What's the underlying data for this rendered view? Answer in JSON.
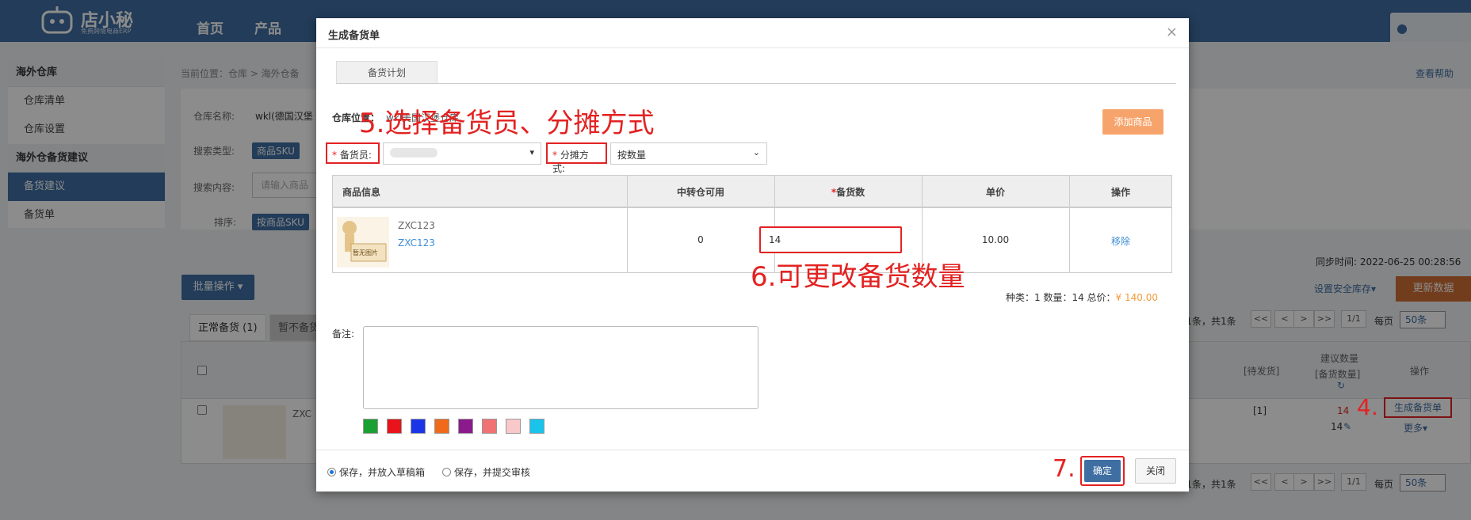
{
  "app": {
    "logo_text": "店小秘",
    "logo_sub": "免费跨境电商ERP",
    "nav": [
      "首页",
      "产品"
    ]
  },
  "sidebar": {
    "group1": "海外仓库",
    "items1": [
      "仓库清单",
      "仓库设置"
    ],
    "group2": "海外仓备货建议",
    "items2": [
      "备货建议",
      "备货单"
    ]
  },
  "bg": {
    "breadcrumb": "当前位置：仓库 > 海外仓备",
    "help": "查看帮助",
    "warehouse_label": "仓库名称:",
    "warehouse_value": "wkl(德国汉堡",
    "search_type_label": "搜索类型:",
    "search_type_value": "商品SKU",
    "search_content_label": "搜索内容:",
    "search_content_placeholder": "请输入商品",
    "sort_label": "排序:",
    "sort_value": "按商品SKU",
    "sync_time": "同步时间: 2022-06-25 00:28:56",
    "batch_label": "批量操作",
    "safe_stock_link": "设置安全库存",
    "update_btn": "更新数据",
    "tab_normal": "正常备货 (1)",
    "tab_pending": "暂不备货",
    "pager_text": "-1条，共1条",
    "pager_page": "1/1",
    "pager_per": "每页",
    "pager_size": "50条",
    "pager_text2": "-1条，共1条",
    "col_pending": "[待发货]",
    "col_suggest": "建议数量",
    "col_suggest2": "[备货数量]",
    "col_action": "操作",
    "row_pending": "[1]",
    "row_suggest": "14",
    "row_qty": "14",
    "row_sku": "ZXC",
    "row_gen": "生成备货单",
    "row_more": "更多",
    "no_image": "暂无图片"
  },
  "modal": {
    "title": "生成备货单",
    "close_icon": "×",
    "tab": "备货计划",
    "warehouse_location_label": "仓库位置：",
    "warehouse_location_value": "wkl美国汉堡仓库",
    "add_product_btn": "添加商品",
    "stocker_label": "备货员:",
    "allocation_label": "分摊方式:",
    "allocation_value": "按数量",
    "table": {
      "headers": [
        "商品信息",
        "中转仓可用",
        "备货数",
        "单价",
        "操作"
      ],
      "row": {
        "sku_gray": "ZXC123",
        "sku_link": "ZXC123",
        "available": "0",
        "qty": "14",
        "price": "10.00",
        "action": "移除",
        "no_image": "暂无图片"
      }
    },
    "summary_prefix": "种类：1  数量：14  总价：",
    "summary_price": "¥ 140.00",
    "notes_label": "备注:",
    "swatches": [
      "#19a032",
      "#e8131b",
      "#1a35e8",
      "#f06a1a",
      "#8b1b8c",
      "#f07272",
      "#f9c8c8",
      "#1ac3ea"
    ],
    "radio1": "保存，并放入草稿箱",
    "radio2": "保存，并提交审核",
    "ok_btn": "确定",
    "close_btn": "关闭"
  },
  "annotations": {
    "a5": "5.选择备货员、分摊方式",
    "a6": "6.可更改备货数量",
    "a4": "4.",
    "a7": "7."
  }
}
